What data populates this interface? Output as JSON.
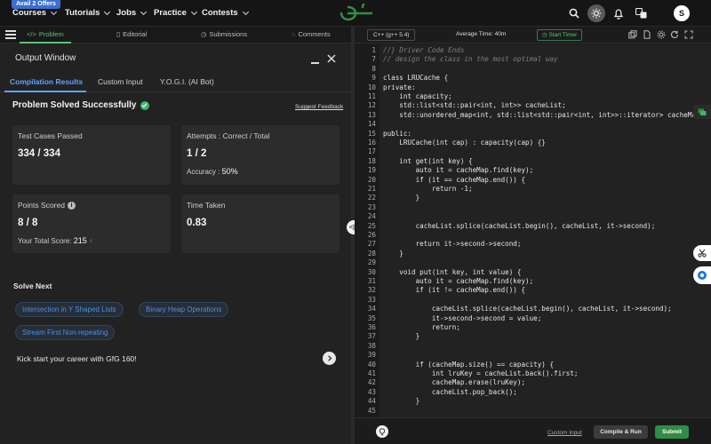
{
  "nav": {
    "offer_badge": "Avail 2 Offers",
    "items": [
      "Courses",
      "Tutorials",
      "Jobs",
      "Practice",
      "Contests"
    ],
    "avatar_initial": "S"
  },
  "left_tabs": {
    "problem": "Problem",
    "editorial": "Editorial",
    "submissions": "Submissions",
    "comments": "Comments"
  },
  "output": {
    "title": "Output Window",
    "tabs": [
      "Compilation Results",
      "Custom Input",
      "Y.O.G.I. (AI Bot)"
    ],
    "status": "Problem Solved Successfully",
    "feedback": "Suggest Feedback",
    "cards": {
      "tests": {
        "label": "Test Cases Passed",
        "value": "334 / 334"
      },
      "attempts": {
        "label": "Attempts : Correct / Total",
        "value": "1 / 2",
        "sub_label": "Accuracy :",
        "sub_value": "50%"
      },
      "points": {
        "label": "Points Scored",
        "value": "8 / 8",
        "sub_label": "Your Total Score:",
        "sub_value": "215"
      },
      "time": {
        "label": "Time Taken",
        "value": "0.83"
      }
    },
    "solve_next": "Solve Next",
    "suggestions": [
      "Intersection in Y Shaped Lists",
      "Binary Heap Operations",
      "Stream First Non-repeating"
    ],
    "promo": "Kick start your career with GfG 160!"
  },
  "editor": {
    "language": "C++ (g++ 5.4)",
    "avg_time": "Average Time: 40m",
    "timer": "Start Timer",
    "lines": [
      {
        "n": "1",
        "t": "//} Driver Code Ends",
        "cm": true
      },
      {
        "n": "7",
        "t": "// design the class in the most optimal way",
        "cm": true
      },
      {
        "n": "8",
        "t": ""
      },
      {
        "n": "9",
        "t": "class LRUCache {"
      },
      {
        "n": "10",
        "t": "private:"
      },
      {
        "n": "11",
        "t": "    int capacity;"
      },
      {
        "n": "12",
        "t": "    std::list<std::pair<int, int>> cacheList;"
      },
      {
        "n": "13",
        "t": "    std::unordered_map<int, std::list<std::pair<int, int>>::iterator> cacheMap;"
      },
      {
        "n": "14",
        "t": ""
      },
      {
        "n": "15",
        "t": "public:"
      },
      {
        "n": "16",
        "t": "    LRUCache(int cap) : capacity(cap) {}"
      },
      {
        "n": "17",
        "t": ""
      },
      {
        "n": "18",
        "t": "    int get(int key) {"
      },
      {
        "n": "19",
        "t": "        auto it = cacheMap.find(key);"
      },
      {
        "n": "20",
        "t": "        if (it == cacheMap.end()) {"
      },
      {
        "n": "21",
        "t": "            return -1;"
      },
      {
        "n": "22",
        "t": "        }"
      },
      {
        "n": "23",
        "t": ""
      },
      {
        "n": "24",
        "t": ""
      },
      {
        "n": "25",
        "t": "        cacheList.splice(cacheList.begin(), cacheList, it->second);"
      },
      {
        "n": "26",
        "t": ""
      },
      {
        "n": "27",
        "t": "        return it->second->second;"
      },
      {
        "n": "28",
        "t": "    }"
      },
      {
        "n": "29",
        "t": ""
      },
      {
        "n": "30",
        "t": "    void put(int key, int value) {"
      },
      {
        "n": "31",
        "t": "        auto it = cacheMap.find(key);"
      },
      {
        "n": "32",
        "t": "        if (it != cacheMap.end()) {"
      },
      {
        "n": "33",
        "t": ""
      },
      {
        "n": "34",
        "t": "            cacheList.splice(cacheList.begin(), cacheList, it->second);"
      },
      {
        "n": "35",
        "t": "            it->second->second = value;"
      },
      {
        "n": "36",
        "t": "            return;"
      },
      {
        "n": "37",
        "t": "        }"
      },
      {
        "n": "38",
        "t": ""
      },
      {
        "n": "39",
        "t": ""
      },
      {
        "n": "40",
        "t": "        if (cacheMap.size() == capacity) {"
      },
      {
        "n": "41",
        "t": "            int lruKey = cacheList.back().first;"
      },
      {
        "n": "42",
        "t": "            cacheMap.erase(lruKey);"
      },
      {
        "n": "43",
        "t": "            cacheList.pop_back();"
      },
      {
        "n": "44",
        "t": "        }"
      },
      {
        "n": "45",
        "t": ""
      }
    ],
    "custom_input": "Custom Input",
    "compile": "Compile & Run",
    "submit": "Submit"
  },
  "colors": {
    "accent_green": "#2f8d46",
    "link_blue": "#5fa3ff"
  }
}
